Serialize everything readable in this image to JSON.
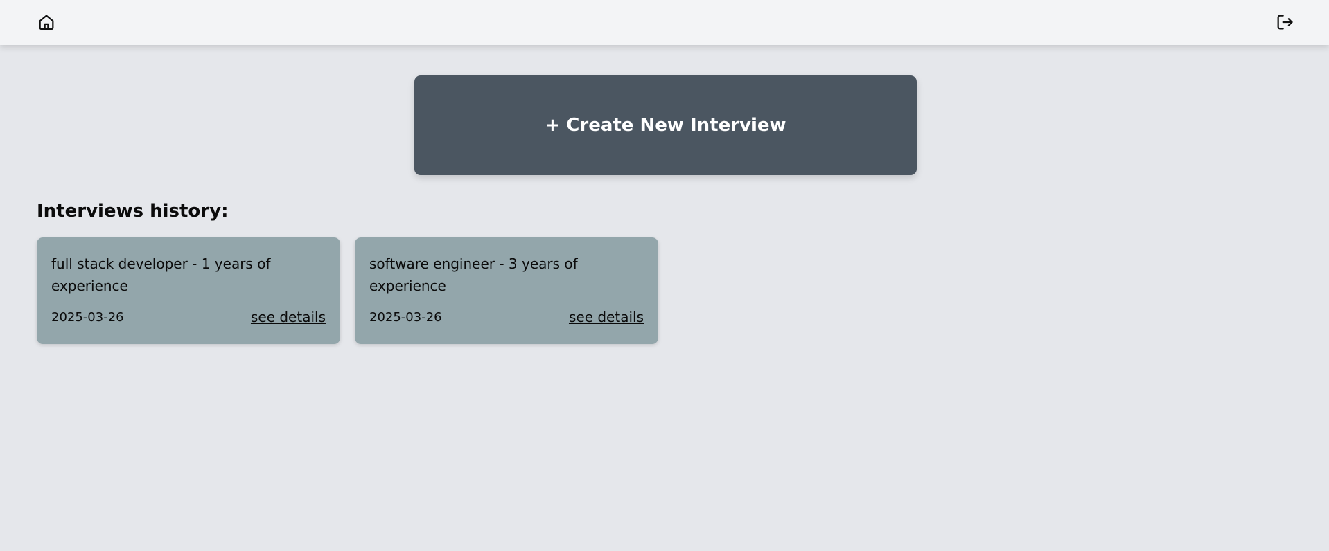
{
  "header": {
    "home_icon": "home-icon",
    "logout_icon": "logout-icon"
  },
  "main": {
    "create_button_label": "+ Create New Interview",
    "history_title": "Interviews history:",
    "interviews": [
      {
        "title": "full stack developer - 1 years of experience",
        "date": "2025-03-26",
        "link_label": "see details"
      },
      {
        "title": "software engineer - 3 years of experience",
        "date": "2025-03-26",
        "link_label": "see details"
      }
    ]
  },
  "colors": {
    "background": "#e5e7eb",
    "topbar": "#f3f4f6",
    "create_button": "#4b5661",
    "card": "#93a6ab"
  }
}
